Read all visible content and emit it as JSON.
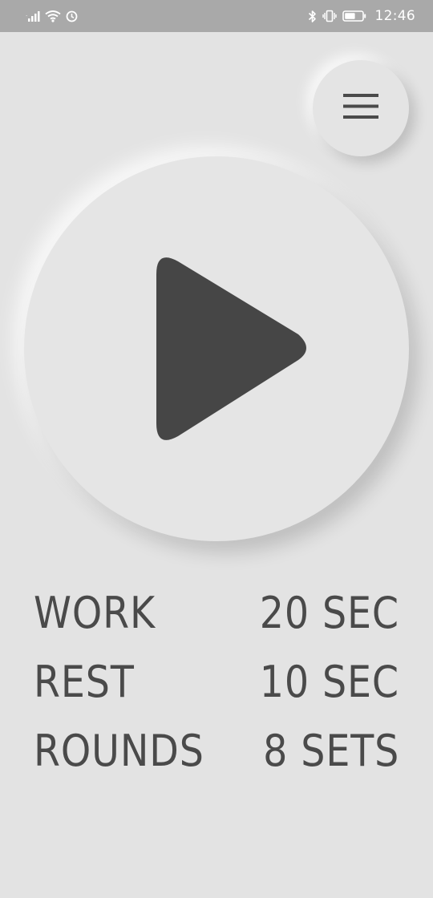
{
  "status_bar": {
    "time": "12:46",
    "icons": [
      "signal-icon",
      "wifi-icon",
      "alarm-icon",
      "bluetooth-icon",
      "vibrate-icon",
      "battery-icon"
    ],
    "battery_level": 0.6,
    "color": "#ffffff",
    "background": "#a9a9a9"
  },
  "menu": {
    "icon": "hamburger-menu-icon"
  },
  "player": {
    "icon": "play-icon",
    "icon_color": "#464646"
  },
  "stats": [
    {
      "label": "WORK",
      "value": "20 SEC"
    },
    {
      "label": "REST",
      "value": "10 SEC"
    },
    {
      "label": "ROUNDS",
      "value": "8 SETS"
    }
  ],
  "colors": {
    "background": "#e3e3e3",
    "text": "#4a4a4a"
  }
}
